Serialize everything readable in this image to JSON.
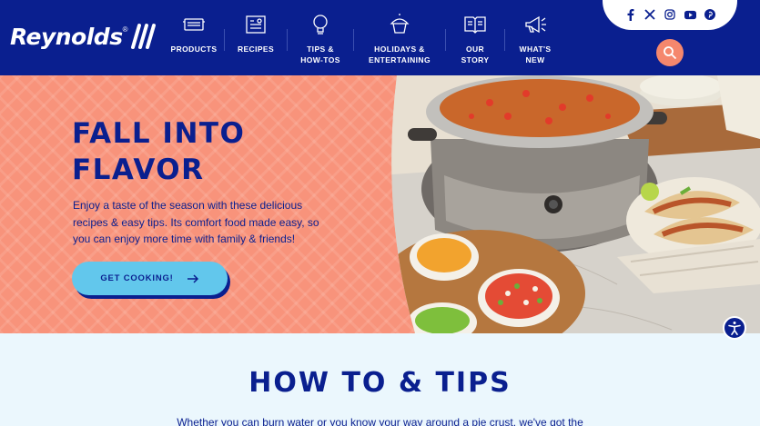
{
  "brand": {
    "name": "Reynolds",
    "trademark": "®"
  },
  "nav": {
    "items": [
      {
        "label": "PRODUCTS",
        "icon": "pan-icon"
      },
      {
        "label": "RECIPES",
        "icon": "recipe-card-icon"
      },
      {
        "label": "TIPS &\nHOW-TOS",
        "icon": "lightbulb-icon"
      },
      {
        "label": "HOLIDAYS &\nENTERTAINING",
        "icon": "cupcake-icon"
      },
      {
        "label": "OUR\nSTORY",
        "icon": "open-book-icon"
      },
      {
        "label": "WHAT'S\nNEW",
        "icon": "megaphone-icon"
      }
    ]
  },
  "social": [
    "facebook-icon",
    "x-icon",
    "instagram-icon",
    "youtube-icon",
    "pinterest-icon"
  ],
  "hero": {
    "title": "FALL INTO\nFLAVOR",
    "text": "Enjoy a taste of the season with these delicious recipes & easy tips. Its comfort food made easy, so you can enjoy more time with family & friends!",
    "cta_label": "GET COOKING!"
  },
  "section": {
    "title": "HOW TO & TIPS",
    "text": "Whether you can burn water or you know your way around a pie crust, we've got the"
  },
  "colors": {
    "navy": "#0a1f8f",
    "coral": "#f8937b",
    "sky": "#62c7ec",
    "search": "#f5876d"
  }
}
